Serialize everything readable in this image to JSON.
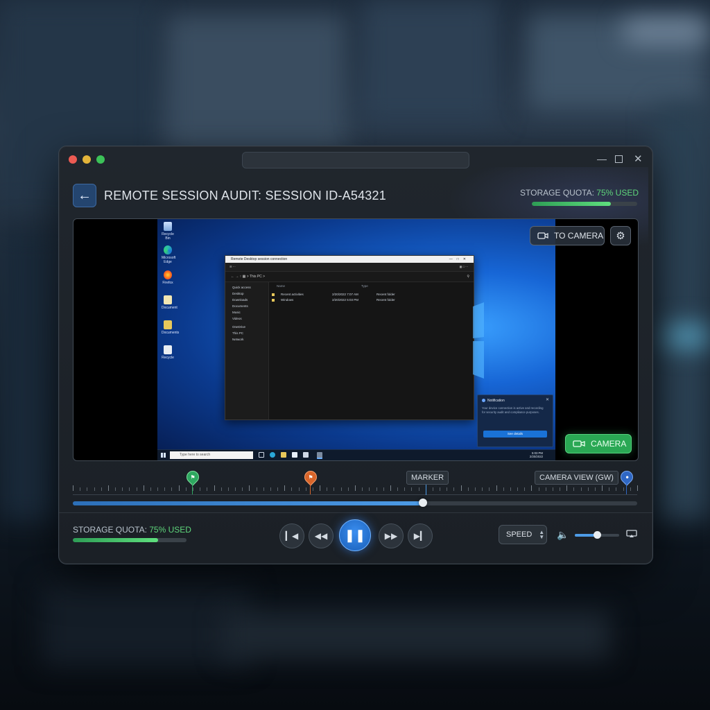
{
  "header": {
    "title": "REMOTE SESSION AUDIT: SESSION ID-A54321",
    "storage_label": "STORAGE QUOTA: ",
    "storage_pct": "75% USED",
    "storage_fraction": 0.75
  },
  "viewer": {
    "to_camera_label": "TO CAMERA",
    "camera_label": "CAMERA",
    "explorer": {
      "window_title": "Remote Desktop session connection",
      "address": "This PC",
      "sidebar": [
        "Quick access",
        "Desktop",
        "Downloads",
        "Documents",
        "Music",
        "Videos",
        "OneDrive",
        "This PC",
        "Network"
      ],
      "rows": [
        {
          "name": "Recent activities",
          "date": "2/20/2022 7:07 AM",
          "type": "Recent folder"
        },
        {
          "name": "Windows",
          "date": "2/20/2022 5:03 PM",
          "type": "Recent folder"
        }
      ]
    },
    "notification": {
      "heading": "Notification",
      "body": "Your device connection is active and recording for security audit and compliance purposes.",
      "button": "See details"
    },
    "taskbar": {
      "search_placeholder": "Type here to search",
      "time": "5:03 PM",
      "date": "2/20/2022"
    }
  },
  "timeline": {
    "marker_label": "MARKER",
    "camera_view_label": "CAMERA VIEW (GW)",
    "progress_fraction": 0.62
  },
  "footer": {
    "storage_label": "STORAGE QUOTA: ",
    "storage_pct": "75% USED",
    "storage_fraction": 0.75,
    "speed_label": "SPEED",
    "volume_fraction": 0.5
  },
  "colors": {
    "accent": "#4d9be6",
    "success": "#5fd67b",
    "marker_green": "#2ea860",
    "marker_orange": "#d9652a",
    "marker_blue": "#2f67c4"
  }
}
